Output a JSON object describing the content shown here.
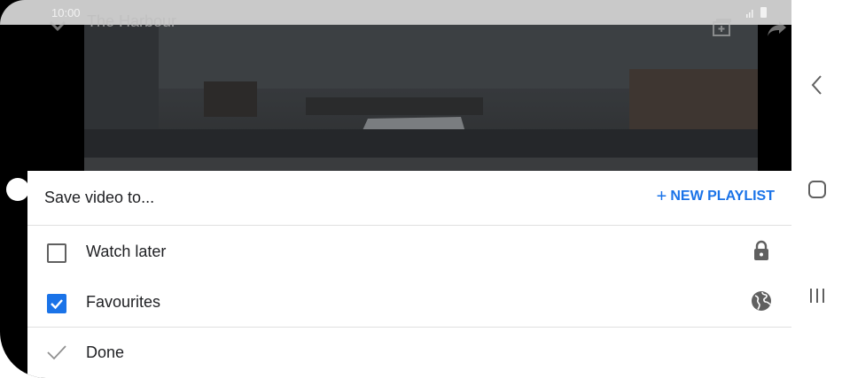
{
  "status_bar": {
    "time": "10:00"
  },
  "video": {
    "title": "The Harbour"
  },
  "sheet": {
    "title": "Save video to...",
    "new_playlist_label": "NEW PLAYLIST",
    "playlists": [
      {
        "label": "Watch later",
        "checked": false,
        "privacy_icon": "lock-icon"
      },
      {
        "label": "Favourites",
        "checked": true,
        "privacy_icon": "globe-icon"
      }
    ],
    "done_label": "Done"
  },
  "colors": {
    "accent": "#1a73e8"
  }
}
